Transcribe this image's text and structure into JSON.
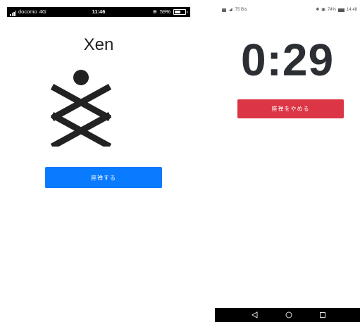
{
  "left_phone": {
    "status_bar": {
      "carrier": "docomo",
      "network": "4G",
      "time": "11:46",
      "battery": "59%",
      "battery_level": 0.59
    },
    "app_title": "Xen",
    "logo_icon": "xen-logo-icon",
    "start_button": "座禅する",
    "colors": {
      "start_button": "#0a7bff"
    }
  },
  "right_phone": {
    "status_bar": {
      "signal_text": "75 B/s",
      "battery": "74%",
      "time": "14:48",
      "battery_level": 0.74
    },
    "timer": "0:29",
    "stop_button": "座禅をやめる",
    "nav": {
      "back_icon": "back-triangle-icon",
      "home_icon": "home-circle-icon",
      "recent_icon": "recent-square-icon"
    },
    "colors": {
      "stop_button": "#dc3545"
    }
  }
}
